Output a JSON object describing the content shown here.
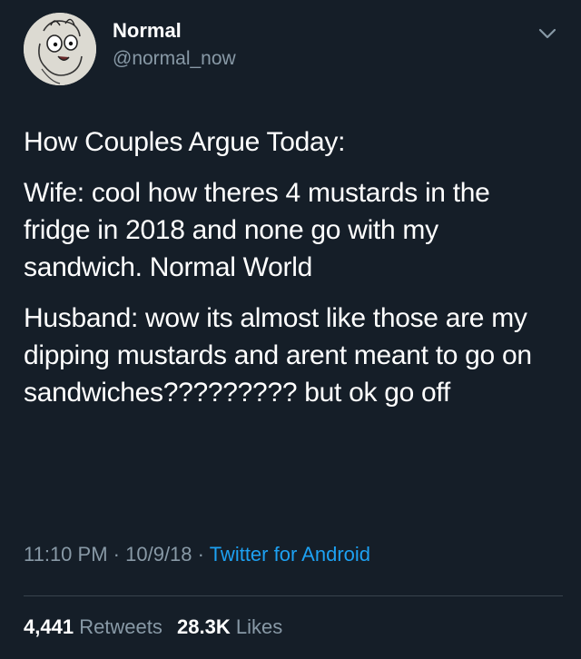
{
  "author": {
    "display_name": "Normal",
    "handle": "@normal_now",
    "avatar_icon": "cartoon-face-avatar"
  },
  "menu_icon": "chevron-down-icon",
  "tweet": {
    "paragraphs": [
      "How Couples Argue Today:",
      "Wife: cool how theres 4 mustards in the fridge in 2018 and none go with my sandwich. Normal World",
      "Husband: wow its almost like those are my dipping mustards and arent meant to go on sandwiches????????? but ok go off"
    ]
  },
  "meta": {
    "time": "11:10 PM",
    "separator": "·",
    "date": "10/9/18",
    "source": "Twitter for Android"
  },
  "stats": {
    "retweets_count": "4,441",
    "retweets_label": "Retweets",
    "likes_count": "28.3K",
    "likes_label": "Likes"
  },
  "colors": {
    "background": "#151e28",
    "primary_text": "#ffffff",
    "secondary_text": "#8899a6",
    "link": "#1da1f2"
  }
}
